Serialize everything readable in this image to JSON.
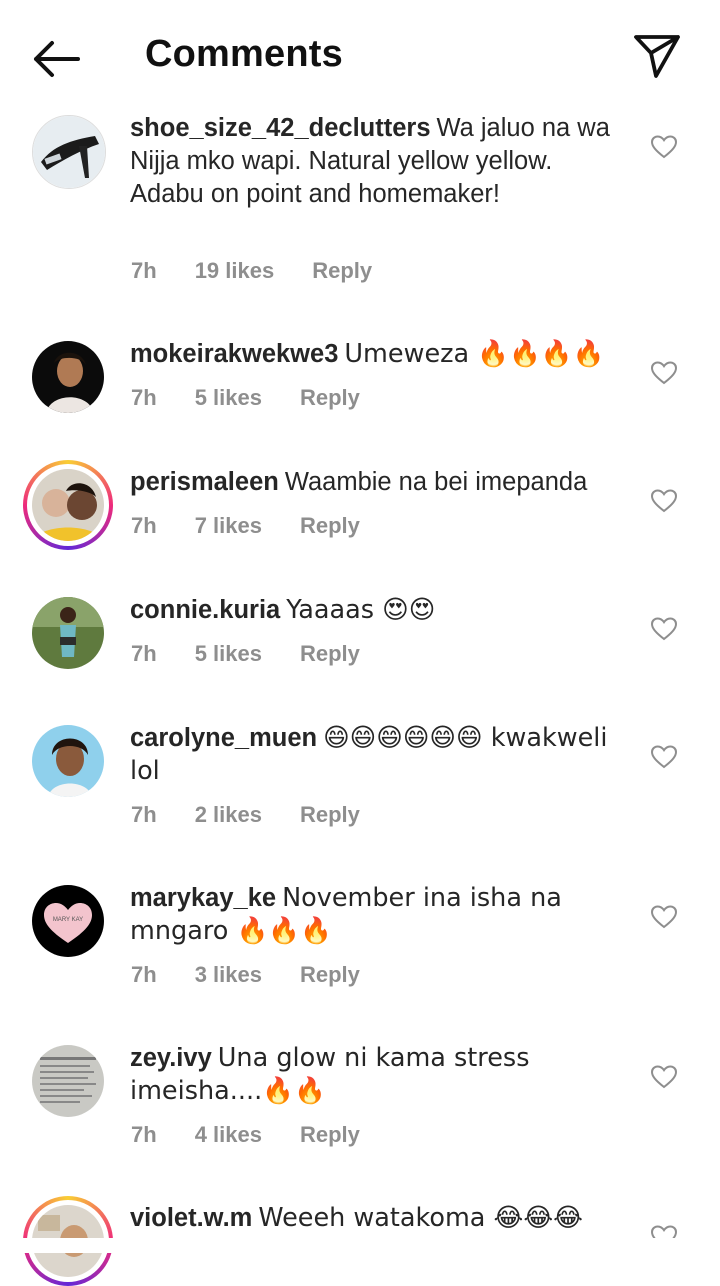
{
  "header": {
    "title": "Comments"
  },
  "comments": [
    {
      "username": "shoe_size_42_declutters",
      "text": "Wa jaluo na wa Nijja mko wapi. Natural yellow yellow.  Adabu on point and homemaker!",
      "time": "7h",
      "likes": "19 likes",
      "reply": "Reply",
      "avatar": "shoe-photo"
    },
    {
      "username": "mokeirakwekwe3",
      "text": "Umeweza 🔥🔥🔥🔥",
      "time": "7h",
      "likes": "5 likes",
      "reply": "Reply",
      "avatar": "portrait-dark"
    },
    {
      "username": "perismaleen",
      "text": "Waambie na bei imepanda",
      "time": "7h",
      "likes": "7 likes",
      "reply": "Reply",
      "avatar": "mother-child-photo",
      "story_ring": true
    },
    {
      "username": "connie.kuria",
      "text": "Yaaaas 😍😍",
      "time": "7h",
      "likes": "5 likes",
      "reply": "Reply",
      "avatar": "outdoor-portrait"
    },
    {
      "username": "carolyne_muen",
      "text": "😄😄😄😄😄😄 kwakweli lol",
      "time": "7h",
      "likes": "2 likes",
      "reply": "Reply",
      "avatar": "portrait-sky"
    },
    {
      "username": "marykay_ke",
      "text": "November ina isha na mngaro 🔥🔥🔥",
      "time": "7h",
      "likes": "3 likes",
      "reply": "Reply",
      "avatar": "marykay-logo",
      "avatar_text": "MARY KAY"
    },
    {
      "username": "zey.ivy",
      "text": "Una glow ni kama stress imeisha....🔥🔥",
      "time": "7h",
      "likes": "4 likes",
      "reply": "Reply",
      "avatar": "text-card"
    },
    {
      "username": "violet.w.m",
      "text": "Weeeh watakoma 😂😂😂",
      "time": "",
      "likes": "",
      "reply": "",
      "avatar": "portrait-light",
      "story_ring": true
    }
  ],
  "colors": {
    "text": "#262626",
    "meta": "#8e8e8e",
    "background": "#ffffff"
  }
}
